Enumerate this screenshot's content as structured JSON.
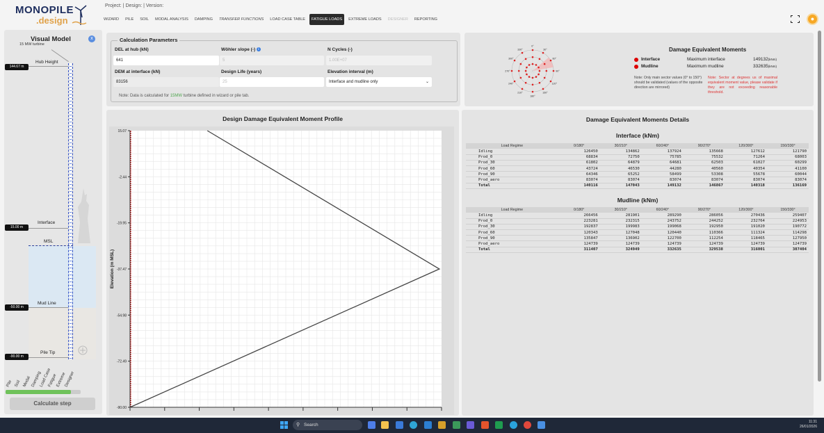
{
  "app": {
    "logo_main": "MONOPILE",
    "logo_sub": ".design",
    "breadcrumb": "Project: | Design: | Version:"
  },
  "nav": {
    "tabs": [
      {
        "label": "WIZARD",
        "state": "normal"
      },
      {
        "label": "PILE",
        "state": "normal"
      },
      {
        "label": "SOIL",
        "state": "normal"
      },
      {
        "label": "MODAL ANALYSIS",
        "state": "normal"
      },
      {
        "label": "DAMPING",
        "state": "normal"
      },
      {
        "label": "TRANSFER FUNCTIONS",
        "state": "italic"
      },
      {
        "label": "LOAD CASE TABLE",
        "state": "normal"
      },
      {
        "label": "FATIGUE LOADS",
        "state": "active"
      },
      {
        "label": "EXTREME LOADS",
        "state": "normal"
      },
      {
        "label": "DESIGNER",
        "state": "disabled"
      },
      {
        "label": "REPORTING",
        "state": "normal"
      }
    ]
  },
  "visual_model": {
    "title": "Visual Model",
    "close": "x",
    "turbine": "15 MW turbine",
    "badges": {
      "hub": "144.67 m",
      "interface": "15.00 m",
      "mudline": "-50.00 m",
      "piletip": "-90.00 m"
    },
    "levels": {
      "hub": "Hub Height",
      "interface": "Interface",
      "msl": "MSL",
      "mudline": "Mud Line",
      "piletip": "Pile Tip"
    },
    "steps": [
      "Pile",
      "Soil",
      "Modal",
      "Damping",
      "Load Case",
      "Fatigue",
      "Extreme",
      "Designer"
    ],
    "progress": 0.87,
    "calc_button": "Calculate step"
  },
  "params": {
    "title": "Calculation Parameters",
    "del_label": "DEL at hub (kN)",
    "del_value": "641",
    "wohler_label": "Wöhler slope (-)",
    "wohler_placeholder": "5",
    "ncycles_label": "N Cycles (-)",
    "ncycles_placeholder": "1.00E+07",
    "dem_label": "DEM at interface (kN)",
    "dem_value": "83156",
    "life_label": "Design Life (years)",
    "life_placeholder": "25",
    "elev_label": "Elevation interval (m)",
    "elev_value": "Interface and mudline only",
    "note_pre": "Note: Data is calculated for ",
    "note_link": "15MW",
    "note_post": " turbine defined in wizard or pile tab."
  },
  "dem_summary": {
    "title": "Damage Equivalent Moments",
    "interface_label": "Interface",
    "interface_desc": "Maximum interface",
    "interface_value": "149132",
    "interface_unit": "(kNm)",
    "mudline_label": "Mudline",
    "mudline_desc": "Maximum mudline",
    "mudline_value": "332635",
    "mudline_unit": "(kNm)",
    "note1": "Note: Only main sector values (0° to 150°) should be validated (values of the opposite direction are mirrored)",
    "note2": "Note: Sector at degrees us of maximal equivalent moment value, please validate if they are not exceeding reasonable threshold.",
    "polar_labels": [
      "0°",
      "30°",
      "60°",
      "90°",
      "120°",
      "150°",
      "180°",
      "210°",
      "240°",
      "270°",
      "300°",
      "330°"
    ],
    "accent": "#dd2222"
  },
  "profile": {
    "title": "Design Damage Equivalent Moment Profile",
    "ylabel": "Elevation (m MSL)"
  },
  "chart_data": {
    "type": "line",
    "title": "Design Damage Equivalent Moment Profile",
    "xlabel": "",
    "ylabel": "Elevation (m MSL)",
    "ylim": [
      -90,
      15.07
    ],
    "yticks": [
      "15.07",
      "-2.44",
      "-19.95",
      "-37.47",
      "-54.98",
      "-72.49",
      "-90.00"
    ],
    "series": [
      {
        "values": [
          {
            "x": 83156,
            "y": 15.07
          },
          {
            "x": 332635,
            "y": -37.47
          },
          {
            "x": 0,
            "y": -90
          }
        ]
      }
    ],
    "xlim": [
      0,
      335000
    ],
    "grid": true
  },
  "details": {
    "title": "Damage Equivalent Moments Details",
    "headers": [
      "Load Regime",
      "0/180°",
      "30/210°",
      "60/240°",
      "90/270°",
      "120/300°",
      "150/330°"
    ],
    "interface_title": "Interface (kNm)",
    "interface_rows": [
      [
        "Idling",
        "126450",
        "134862",
        "137924",
        "135668",
        "127612",
        "121790"
      ],
      [
        "Prod_0",
        "68834",
        "72750",
        "75785",
        "75532",
        "71264",
        "68003"
      ],
      [
        "Prod_30",
        "61802",
        "64879",
        "64681",
        "62503",
        "61027",
        "60299"
      ],
      [
        "Prod_60",
        "43724",
        "46530",
        "44280",
        "40560",
        "40354",
        "41100"
      ],
      [
        "Prod_90",
        "64346",
        "65252",
        "58499",
        "53308",
        "55678",
        "60044"
      ],
      [
        "Prod_aero",
        "83074",
        "83074",
        "83074",
        "83074",
        "83074",
        "83074"
      ],
      [
        "Total",
        "140116",
        "147043",
        "149132",
        "146867",
        "140318",
        "136169"
      ]
    ],
    "mudline_title": "Mudline (kNm)",
    "mudline_rows": [
      [
        "Idling",
        "266456",
        "281901",
        "289290",
        "286056",
        "270436",
        "259407"
      ],
      [
        "Prod_0",
        "223281",
        "232315",
        "243752",
        "244252",
        "232764",
        "224953"
      ],
      [
        "Prod_30",
        "192837",
        "199983",
        "199068",
        "192950",
        "191020",
        "190772"
      ],
      [
        "Prod_60",
        "120343",
        "127048",
        "120440",
        "110366",
        "111324",
        "114298"
      ],
      [
        "Prod_90",
        "135847",
        "136902",
        "122700",
        "112254",
        "118465",
        "127950"
      ],
      [
        "Prod_aero",
        "124739",
        "124739",
        "124739",
        "124739",
        "124739",
        "124739"
      ],
      [
        "Total",
        "311407",
        "324949",
        "332635",
        "329538",
        "316001",
        "307404"
      ]
    ]
  },
  "taskbar": {
    "search": "Search",
    "time": "11:31",
    "date": "26/01/2026"
  }
}
